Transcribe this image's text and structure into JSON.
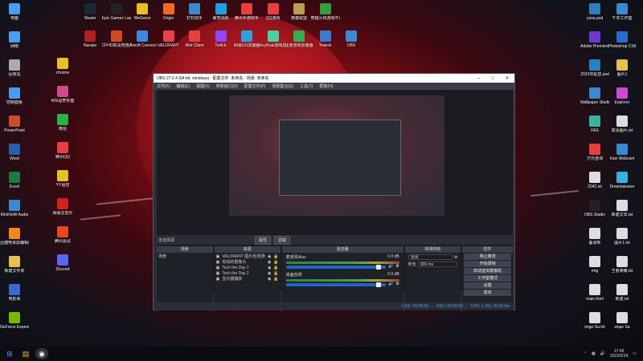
{
  "desktop": {
    "left_icons": [
      {
        "label": "电脑",
        "color": "#4a9cf0"
      },
      {
        "label": "网络",
        "color": "#4a9cf0"
      },
      {
        "label": "回收站",
        "color": "#aab"
      },
      {
        "label": "控制面板",
        "color": "#4a9cf0"
      },
      {
        "label": "PowerPoint",
        "color": "#d04a2a"
      },
      {
        "label": "Word",
        "color": "#2a5cb0"
      },
      {
        "label": "Excel",
        "color": "#1e7a40"
      },
      {
        "label": "KiloRinW Audio",
        "color": "#3a8ad0"
      },
      {
        "label": "迅捷电录屏编辑器",
        "color": "#f08a20"
      },
      {
        "label": "新建文件夹",
        "color": "#e8c050"
      },
      {
        "label": "电影库",
        "color": "#3a6ad0"
      },
      {
        "label": "GeForce Experience",
        "color": "#76b900"
      }
    ],
    "col2_icons": [
      {
        "label": "chrome",
        "color": "#e8c020"
      },
      {
        "label": "MSI运势实盘",
        "color": "#d04a8a"
      },
      {
        "label": "微信",
        "color": "#2ab04a"
      },
      {
        "label": "腾讯QQ",
        "color": "#e84040"
      },
      {
        "label": "YY语音",
        "color": "#e8c020"
      },
      {
        "label": "网易云音乐",
        "color": "#d02020"
      },
      {
        "label": "腾讯会议",
        "color": "#e84a20"
      },
      {
        "label": "Discord",
        "color": "#5865f2"
      }
    ],
    "top_icons": [
      {
        "label": "Steam",
        "color": "#1b2838"
      },
      {
        "label": "Epic Games Launcher",
        "color": "#222"
      },
      {
        "label": "WeGame",
        "color": "#e8c020"
      },
      {
        "label": "Origin",
        "color": "#f06a20"
      },
      {
        "label": "钉钉助手",
        "color": "#3a8ad0"
      },
      {
        "label": "暴雪战网",
        "color": "#1ea0e0"
      },
      {
        "label": "腾讯手游助手",
        "color": "#e84040"
      },
      {
        "label": "QQ游戏",
        "color": "#e84040"
      },
      {
        "label": "英雄联盟",
        "color": "#b8a050"
      },
      {
        "label": "穿越火线游戏平台",
        "color": "#30a040"
      }
    ],
    "top_icons_row2": [
      {
        "label": "Naraka",
        "color": "#b02020"
      },
      {
        "label": "CFHD高清竞技大区",
        "color": "#d04a20"
      },
      {
        "label": "Ubisoft Connect",
        "color": "#3a8ae0"
      },
      {
        "label": "VALORANT",
        "color": "#e84050"
      },
      {
        "label": "Riot Client",
        "color": "#e84040"
      },
      {
        "label": "Twitch",
        "color": "#9146ff"
      },
      {
        "label": "网易UU加速器",
        "color": "#30a0e0"
      },
      {
        "label": "VeryKuai游戏加速器",
        "color": "#4ad0a0"
      },
      {
        "label": "迅游游戏加速器",
        "color": "#30b050"
      },
      {
        "label": "Todesk",
        "color": "#3a7ad0"
      },
      {
        "label": "OBS",
        "color": "#3a8ad0"
      }
    ],
    "right_icons": [
      {
        "label": "yuna.psd",
        "color": "#2a80c0"
      },
      {
        "label": "千年工作室",
        "color": "#3a8ad0"
      },
      {
        "label": "Adobe Premiere Pro",
        "color": "#6a3ad0"
      },
      {
        "label": "Photoshop CS6",
        "color": "#2a6ad0"
      },
      {
        "label": "2023年配音.psd",
        "color": "#2a80c0"
      },
      {
        "label": "图片1",
        "color": "#e8c050"
      },
      {
        "label": "Wallpaper Studio",
        "color": "#3a8ad0"
      },
      {
        "label": "Explorer",
        "color": "#d04ad0"
      },
      {
        "label": "FAS",
        "color": "#3ab0a0"
      },
      {
        "label": "高清图片.txt",
        "color": "#ddd"
      },
      {
        "label": "万元咨询",
        "color": "#e84040"
      },
      {
        "label": "Iriun Webcam",
        "color": "#3a8ad0"
      },
      {
        "label": "2042.txt",
        "color": "#ddd"
      },
      {
        "label": "Dreamweaver",
        "color": "#3ab0e0"
      },
      {
        "label": "OBS Studio",
        "color": "#222"
      },
      {
        "label": "新建文本.txt",
        "color": "#ddd"
      },
      {
        "label": "备录新",
        "color": "#ddd"
      },
      {
        "label": "图片1.txt",
        "color": "#ddd"
      },
      {
        "label": "rmg",
        "color": "#ddd"
      },
      {
        "label": "王者荣耀.txt",
        "color": "#ddd"
      },
      {
        "label": "main.html",
        "color": "#ddd"
      },
      {
        "label": "新建.txt",
        "color": "#ddd"
      },
      {
        "label": "imge-Sa.txt",
        "color": "#ddd"
      },
      {
        "label": "ziqse Sa",
        "color": "#ddd"
      }
    ]
  },
  "obs": {
    "title": "OBS 27.2.4 (64-bit, windows) - 配置文件: 未命名 - 场景: 未命名",
    "menu": [
      "文件(F)",
      "编辑(E)",
      "视图(V)",
      "停靠窗口(D)",
      "配置文件(P)",
      "场景集合(S)",
      "工具(T)",
      "帮助(H)"
    ],
    "no_source_label": "未选择源",
    "properties_btn": "属性",
    "filters_btn": "滤镜",
    "docks": {
      "scenes": {
        "header": "场景",
        "items": [
          "场景"
        ]
      },
      "sources": {
        "header": "来源",
        "items": [
          "VALORANT 图片检测游戏",
          "有线的摄像头",
          "Tech the Day 1",
          "Tech the Day 2",
          "显示器捕获"
        ]
      },
      "mixer": {
        "header": "混音器",
        "channels": [
          {
            "name": "麦克风/Aux",
            "db": "0.0 dB"
          },
          {
            "name": "桌面音频",
            "db": "0.0 dB"
          }
        ]
      },
      "transitions": {
        "header": "转场特效",
        "type_label": "淡出",
        "duration_label": "时长",
        "duration_value": "300 ms"
      },
      "controls": {
        "header": "控件",
        "buttons": [
          "停止推流",
          "开始录制",
          "启动虚拟摄像机",
          "工作室模式",
          "设置",
          "退出"
        ]
      }
    },
    "status": {
      "live": "LIVE: 00:00:00",
      "rec": "REC: 00:00:00",
      "cpu": "CPU: 1.4%, 30.00 fps"
    }
  },
  "taskbar": {
    "time": "17:46",
    "date": "2022/5/24"
  }
}
